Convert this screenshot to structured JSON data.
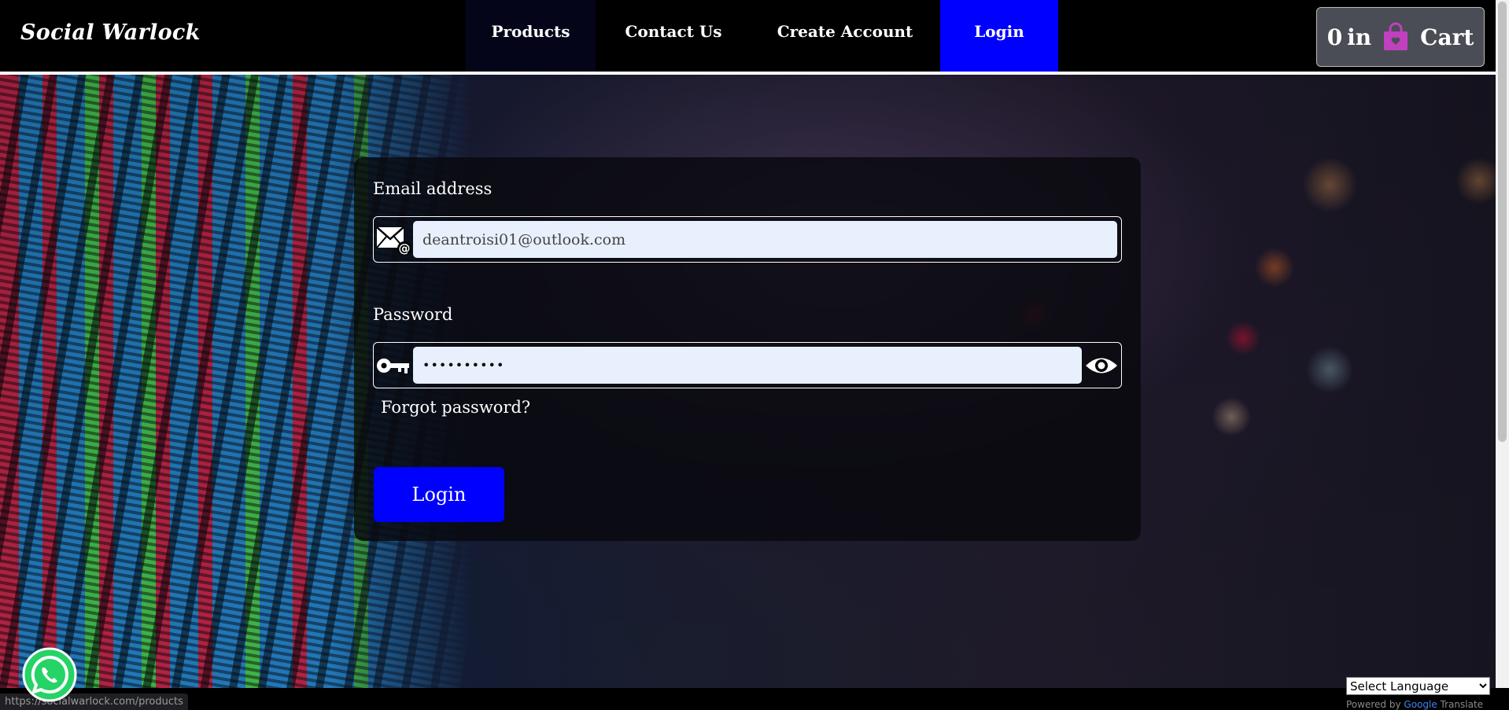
{
  "navbar": {
    "brand": "Social Warlock",
    "links": {
      "products": "Products",
      "contact": "Contact Us",
      "create_account": "Create Account",
      "login": "Login"
    },
    "cart": {
      "count": "0",
      "in_text": "in",
      "label": "Cart",
      "icon": "shopping-bag-icon"
    }
  },
  "form": {
    "email_label": "Email address",
    "email_value": "deantroisi01@outlook.com",
    "password_label": "Password",
    "password_value": "••••••••••",
    "forgot_label": "Forgot password?",
    "login_button": "Login"
  },
  "footer": {
    "status_url": "https://socialwarlock.com/products",
    "language_select": "Select Language",
    "powered_by": "Powered by",
    "google": "Google",
    "translate": "Translate"
  },
  "colors": {
    "accent_blue": "#0000ff",
    "cart_bag": "#c040c0",
    "input_bg": "#e8f0fe",
    "whatsapp_green": "#25d366"
  }
}
